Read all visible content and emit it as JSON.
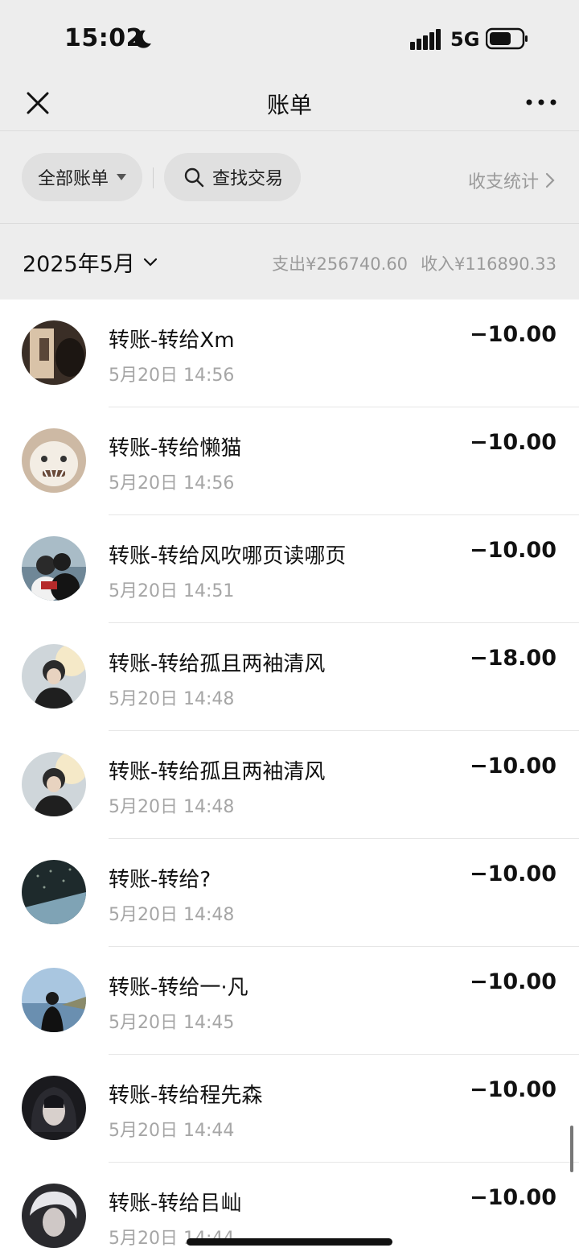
{
  "status_bar": {
    "time": "15:02",
    "network": "5G",
    "icons": [
      "moon-icon",
      "signal-icon",
      "battery-icon"
    ]
  },
  "nav": {
    "title": "账单",
    "left_icon": "close-icon",
    "right_icon": "more-icon"
  },
  "filters": {
    "all_label": "全部账单",
    "search_label": "查找交易",
    "stats_label": "收支统计"
  },
  "month": {
    "label": "2025年5月",
    "expense": "支出¥256740.60",
    "income": "收入¥116890.33"
  },
  "transactions": [
    {
      "title": "转账-转给Xm",
      "time": "5月20日 14:56",
      "amount": "−10.00"
    },
    {
      "title": "转账-转给懒猫",
      "time": "5月20日 14:56",
      "amount": "−10.00"
    },
    {
      "title": "转账-转给风吹哪页读哪页",
      "time": "5月20日 14:51",
      "amount": "−10.00"
    },
    {
      "title": "转账-转给孤且两袖清风",
      "time": "5月20日 14:48",
      "amount": "−18.00"
    },
    {
      "title": "转账-转给孤且两袖清风",
      "time": "5月20日 14:48",
      "amount": "−10.00"
    },
    {
      "title": "转账-转给?",
      "time": "5月20日 14:48",
      "amount": "−10.00"
    },
    {
      "title": "转账-转给一·凡",
      "time": "5月20日 14:45",
      "amount": "−10.00"
    },
    {
      "title": "转账-转给程先森",
      "time": "5月20日 14:44",
      "amount": "−10.00"
    },
    {
      "title": "转账-转给㠯屾",
      "time": "5月20日 14:44",
      "amount": "−10.00"
    }
  ],
  "colors": {
    "background": "#ededed",
    "list_background": "#ffffff",
    "muted_text": "#9a9a9a"
  }
}
